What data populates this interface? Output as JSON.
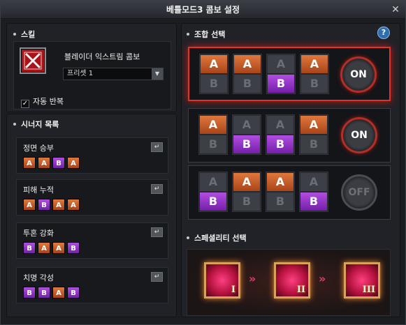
{
  "window": {
    "title": "베틀모드3 콤보 설정",
    "close": "✕"
  },
  "skill_section": {
    "title": "스킬",
    "skill_name": "블레이더 익스트림 콤보",
    "preset_value": "프리셋 1",
    "auto_repeat_label": "자동 반복",
    "auto_repeat_checked": "✓"
  },
  "synergy_section": {
    "title": "시너지 목록",
    "enter_glyph": "↵",
    "items": [
      {
        "label": "정면 승부",
        "combo": [
          "A",
          "A",
          "B",
          "A"
        ]
      },
      {
        "label": "피해 누적",
        "combo": [
          "A",
          "B",
          "A",
          "A"
        ]
      },
      {
        "label": "투혼 강화",
        "combo": [
          "B",
          "A",
          "A",
          "B"
        ]
      },
      {
        "label": "치명 각성",
        "combo": [
          "B",
          "B",
          "A",
          "B"
        ]
      }
    ]
  },
  "combo_section": {
    "title": "조합 선택",
    "help": "?",
    "rows": [
      {
        "selected": [
          "A",
          "A",
          "B",
          "A"
        ],
        "toggle": "ON",
        "active": true
      },
      {
        "selected": [
          "A",
          "B",
          "B",
          "A"
        ],
        "toggle": "ON",
        "active": false
      },
      {
        "selected": [
          "B",
          "A",
          "A",
          "B"
        ],
        "toggle": "OFF",
        "active": false
      }
    ]
  },
  "speciality_section": {
    "title": "스페셜리티 선택",
    "items": [
      "I",
      "II",
      "III"
    ],
    "arrow": "»"
  },
  "colors": {
    "accent_A": "#d0602a",
    "accent_B": "#9b3cd4",
    "active_border": "#e0332c"
  }
}
